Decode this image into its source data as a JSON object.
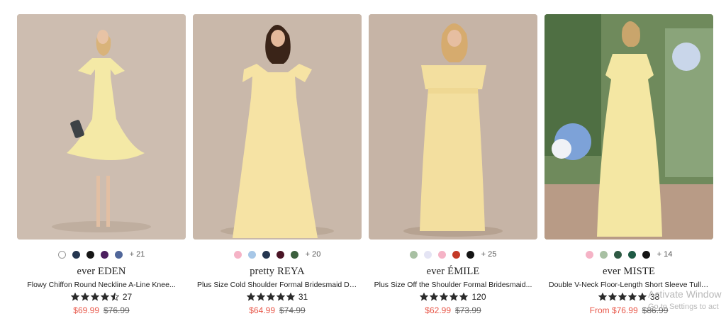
{
  "products": [
    {
      "brand": "ever EDEN",
      "title": "Flowy Chiffon Round Neckline A-Line Knee...",
      "colors": [
        "#ffffff",
        "#243650",
        "#161616",
        "#4c1f5e",
        "#51679a"
      ],
      "more_colors": "+ 21",
      "rating": 4.5,
      "review_count": "27",
      "price": "$69.99",
      "original_price": "$76.99",
      "dress_color": "#f4e9a6"
    },
    {
      "brand": "pretty REYA",
      "title": "Plus Size Cold Shoulder Formal Bridesmaid Dres...",
      "colors": [
        "#f5b3c6",
        "#a7c7e7",
        "#243650",
        "#4a1426",
        "#3b5f3d"
      ],
      "more_colors": "+ 20",
      "rating": 5,
      "review_count": "31",
      "price": "$64.99",
      "original_price": "$74.99",
      "dress_color": "#f6e3a4"
    },
    {
      "brand": "ever ÉMILE",
      "title": "Plus Size Off the Shoulder Formal Bridesmaid...",
      "colors": [
        "#a8c0a3",
        "#e4e4f4",
        "#f5b3c6",
        "#c43a27",
        "#141414"
      ],
      "more_colors": "+ 25",
      "rating": 5,
      "review_count": "120",
      "price": "$62.99",
      "original_price": "$73.99",
      "dress_color": "#f3df9f"
    },
    {
      "brand": "ever MISTE",
      "title": "Double V-Neck Floor-Length Short Sleeve Tulle...",
      "colors": [
        "#f5b3c6",
        "#a8c0a3",
        "#2f5a44",
        "#1e5a45",
        "#141414"
      ],
      "more_colors": "+ 14",
      "rating": 5,
      "review_count": "38",
      "price": "From $76.99",
      "original_price": "$86.99",
      "dress_color": "#f4e7a3"
    }
  ],
  "watermark": {
    "line1": "Activate Window",
    "line2": "Go to Settings to act"
  }
}
